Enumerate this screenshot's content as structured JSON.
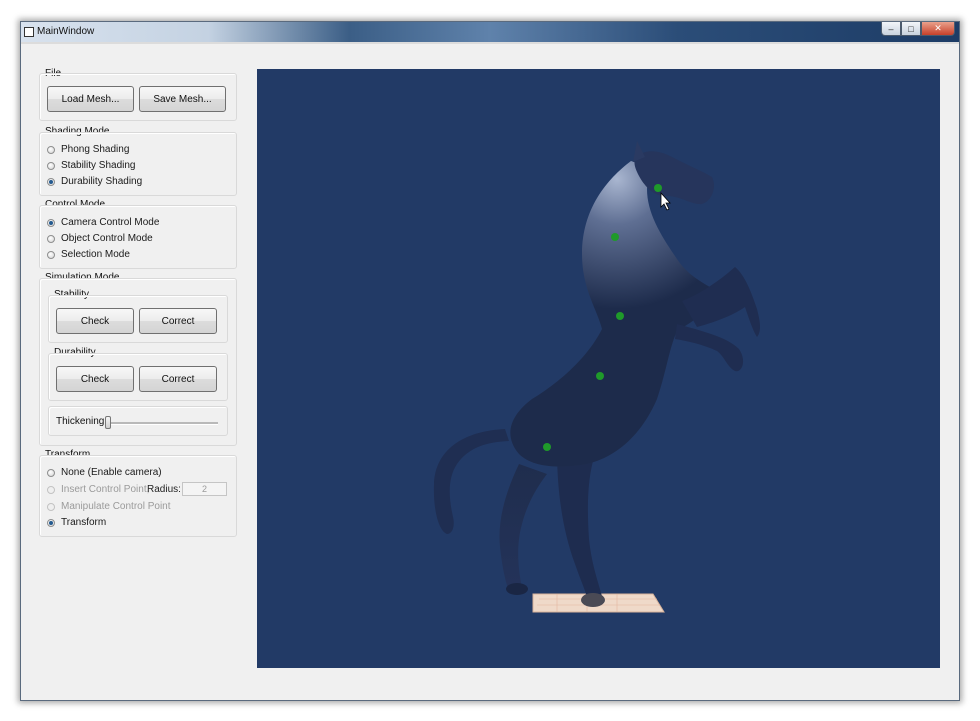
{
  "window": {
    "title": "MainWindow",
    "controls": {
      "minimize": "–",
      "maximize": "□",
      "close": "✕"
    }
  },
  "file": {
    "title": "File",
    "load_label": "Load Mesh...",
    "save_label": "Save Mesh..."
  },
  "shading": {
    "title": "Shading Mode",
    "options": [
      "Phong Shading",
      "Stability Shading",
      "Durability Shading"
    ],
    "selected": 2
  },
  "control": {
    "title": "Control Mode",
    "options": [
      "Camera Control Mode",
      "Object Control Mode",
      "Selection Mode"
    ],
    "selected": 0
  },
  "simulation": {
    "title": "Simulation Mode",
    "stability": {
      "title": "Stability",
      "check_label": "Check",
      "correct_label": "Correct"
    },
    "durability": {
      "title": "Durability",
      "check_label": "Check",
      "correct_label": "Correct"
    },
    "thickening": {
      "label": "Thickening",
      "value": 0.0
    }
  },
  "transform": {
    "title": "Transform",
    "options": [
      "None (Enable camera)",
      "Insert Control Point,",
      "Manipulate Control Point",
      "Transform"
    ],
    "radius_label": "Radius:",
    "radius_value": "2",
    "selected": 3
  },
  "viewport": {
    "background": "#223a66",
    "model": "rearing-horse-mesh",
    "control_point_color": "#1f9a2a",
    "control_points": 5
  }
}
